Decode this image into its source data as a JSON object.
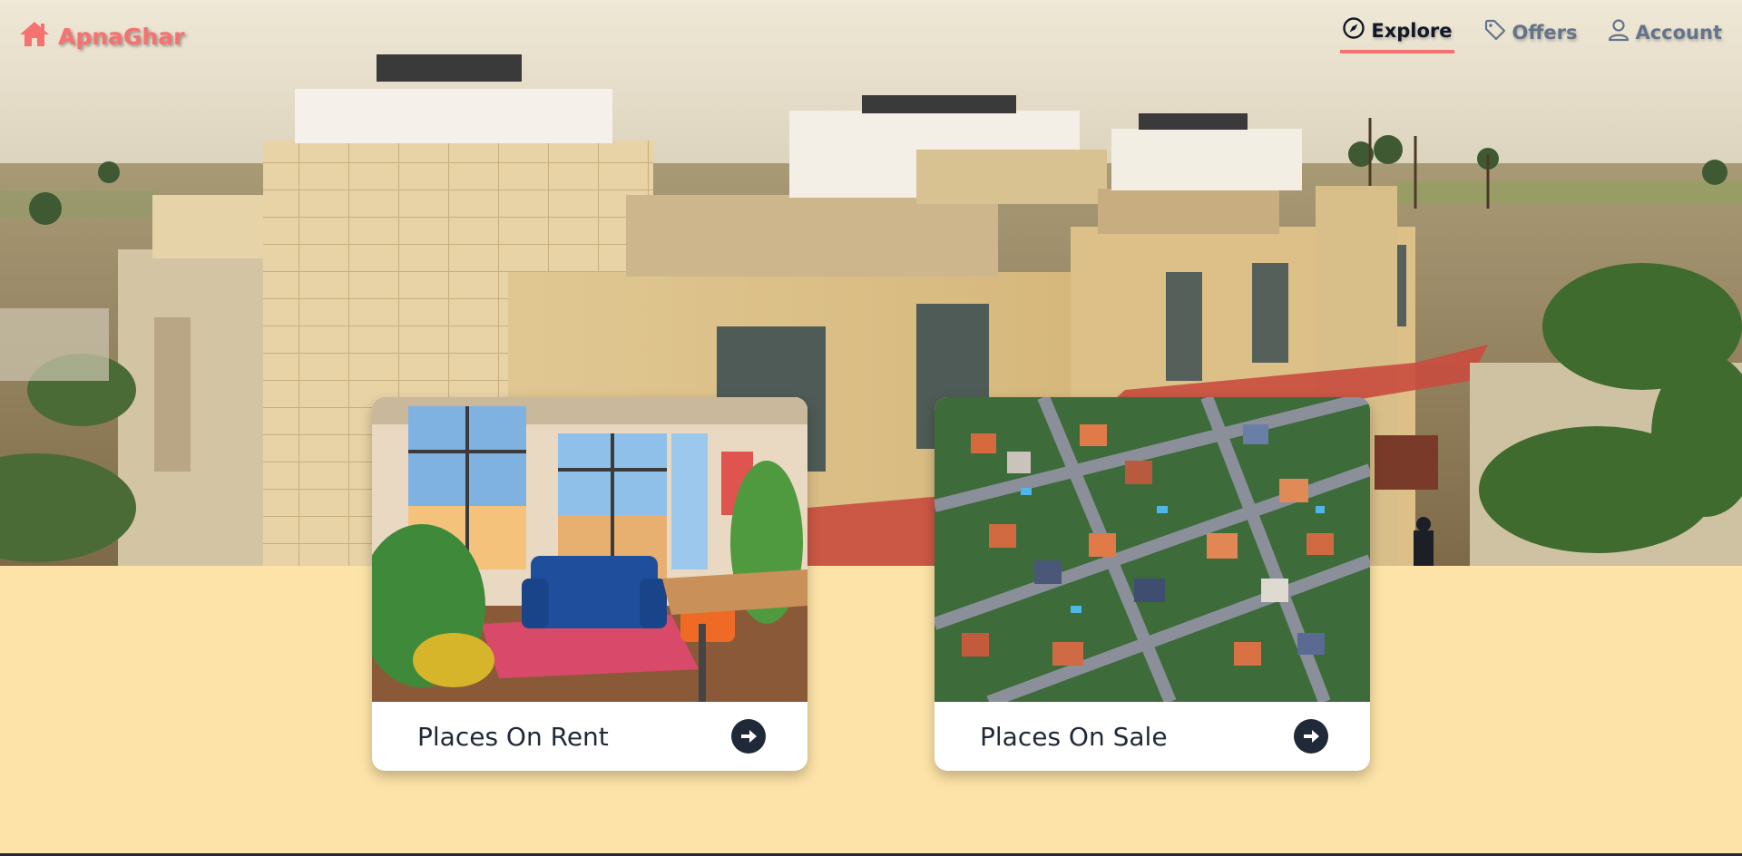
{
  "brand": {
    "name": "ApnaGhar",
    "icon": "house-icon",
    "color": "#f87171"
  },
  "nav": {
    "items": [
      {
        "label": "Explore",
        "icon": "compass-icon",
        "active": true
      },
      {
        "label": "Offers",
        "icon": "tag-icon",
        "active": false
      },
      {
        "label": "Account",
        "icon": "user-icon",
        "active": false
      }
    ]
  },
  "cards": [
    {
      "title": "Places On Rent",
      "image": "living-room-photo",
      "action_icon": "arrow-right-circle-icon"
    },
    {
      "title": "Places On Sale",
      "image": "aerial-neighborhood-photo",
      "action_icon": "arrow-right-circle-icon"
    }
  ],
  "colors": {
    "accent": "#f87171",
    "page_background": "#fde3a7",
    "text_dark": "#1f2937",
    "nav_muted": "#64748b"
  }
}
